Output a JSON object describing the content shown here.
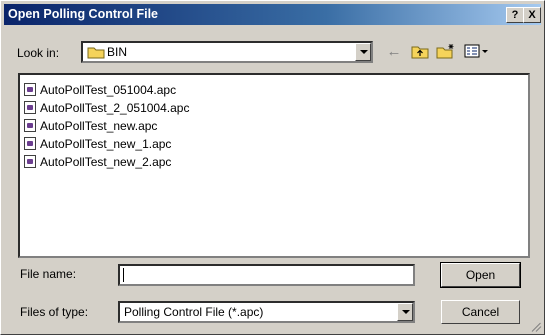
{
  "titlebar": {
    "title": "Open Polling Control File",
    "help": "?",
    "close": "X"
  },
  "look_in": {
    "label": "Look in:",
    "value": "BIN"
  },
  "toolbar": {
    "back_icon": "back-arrow",
    "up_icon": "up-folder",
    "new_folder_icon": "new-folder",
    "view_icon": "view-menu"
  },
  "files": [
    {
      "name": "AutoPollTest_051004.apc"
    },
    {
      "name": "AutoPollTest_2_051004.apc"
    },
    {
      "name": "AutoPollTest_new.apc"
    },
    {
      "name": "AutoPollTest_new_1.apc"
    },
    {
      "name": "AutoPollTest_new_2.apc"
    }
  ],
  "file_name": {
    "label": "File name:",
    "value": ""
  },
  "file_type": {
    "label": "Files of type:",
    "value": "Polling Control File (*.apc)"
  },
  "buttons": {
    "open": "Open",
    "cancel": "Cancel"
  }
}
